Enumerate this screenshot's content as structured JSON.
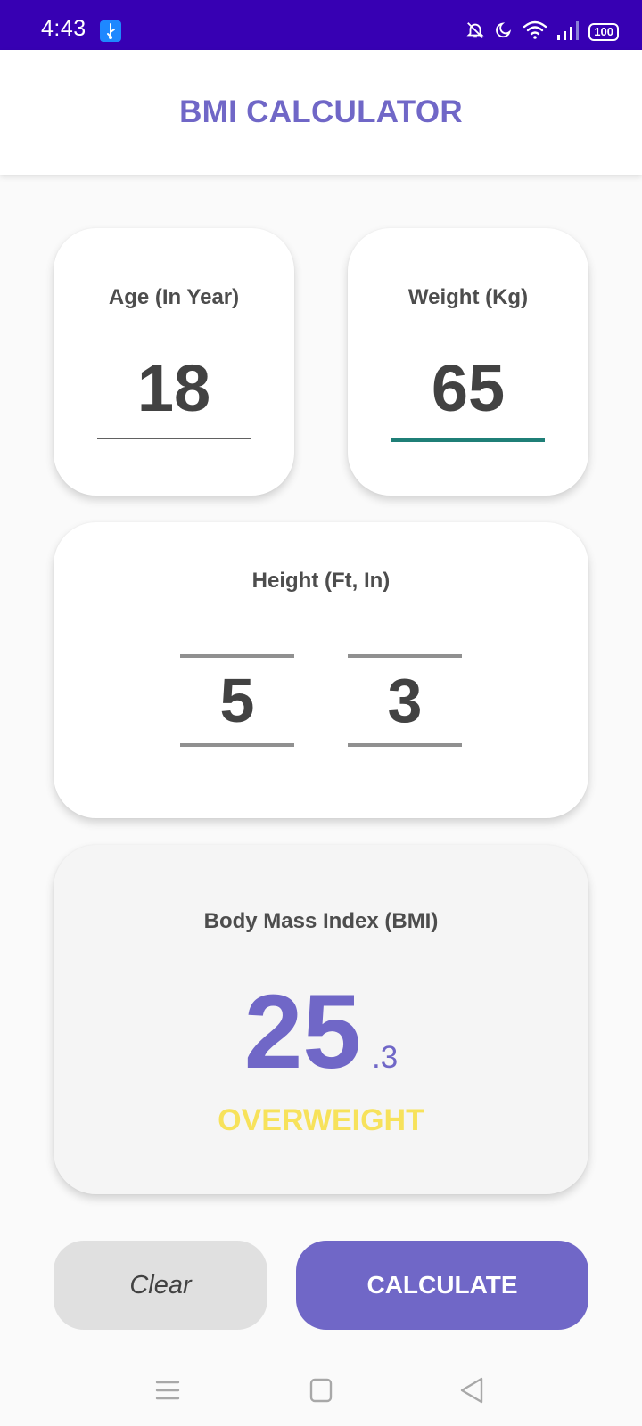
{
  "status_bar": {
    "time": "4:43",
    "battery": "100",
    "icons": [
      "usb-icon",
      "mute-icon",
      "moon-icon",
      "wifi-icon",
      "signal-icon",
      "battery-icon"
    ]
  },
  "app_bar": {
    "title": "BMI CALCULATOR"
  },
  "age": {
    "label": "Age (In Year)",
    "value": "18"
  },
  "weight": {
    "label": "Weight (Kg)",
    "value": "65"
  },
  "height": {
    "label": "Height (Ft, In)",
    "feet": "5",
    "inches": "3"
  },
  "bmi": {
    "label": "Body Mass Index (BMI)",
    "integer": "25",
    "decimal": ".3",
    "status": "OVERWEIGHT"
  },
  "buttons": {
    "clear": "Clear",
    "calculate": "CALCULATE"
  },
  "nav": {
    "icons": [
      "menu-icon",
      "home-icon",
      "back-icon"
    ]
  },
  "colors": {
    "status_bar": "#3700b3",
    "primary": "#7067c7",
    "focus_underline": "#1f7f77",
    "overweight": "#f7e25b",
    "clear_button": "#e0e0e0"
  }
}
